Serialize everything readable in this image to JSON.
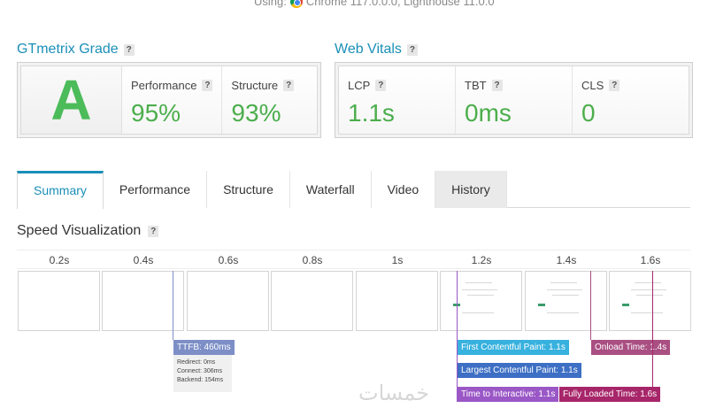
{
  "header": {
    "using_label": "Using:",
    "browser": "Chrome 117.0.0.0, Lighthouse 11.0.0"
  },
  "grade": {
    "title": "GTmetrix Grade",
    "help": "?",
    "letter": "A",
    "performance_label": "Performance",
    "performance_value": "95%",
    "structure_label": "Structure",
    "structure_value": "93%"
  },
  "vitals": {
    "title": "Web Vitals",
    "help": "?",
    "items": [
      {
        "label": "LCP",
        "value": "1.1s"
      },
      {
        "label": "TBT",
        "value": "0ms"
      },
      {
        "label": "CLS",
        "value": "0"
      }
    ]
  },
  "tabs": [
    {
      "label": "Summary"
    },
    {
      "label": "Performance"
    },
    {
      "label": "Structure"
    },
    {
      "label": "Waterfall"
    },
    {
      "label": "Video"
    },
    {
      "label": "History"
    }
  ],
  "speed": {
    "title": "Speed Visualization",
    "help": "?",
    "ticks": [
      "0.2s",
      "0.4s",
      "0.6s",
      "0.8s",
      "1s",
      "1.2s",
      "1.4s",
      "1.6s"
    ],
    "ttfb": {
      "label": "TTFB: 460ms",
      "redirect": "Redirect: 0ms",
      "connect": "Connect: 306ms",
      "backend": "Backend: 154ms"
    },
    "fcp": "First Contentful Paint: 1.1s",
    "lcp": "Largest Contentful Paint: 1.1s",
    "tti": "Time to Interactive: 1.1s",
    "onload": "Onload Time: 1.4s",
    "fully_loaded": "Fully Loaded Time: 1.6s"
  },
  "colors": {
    "accent": "#1a8fb8",
    "grade_green": "#4cbb5a",
    "ttfb": "#7d8fc6",
    "fcp": "#37b1de",
    "lcp": "#3d6fc4",
    "tti": "#9a57c6",
    "onload": "#a94f82",
    "fully_loaded": "#a7266a"
  },
  "watermark": "خمسات"
}
